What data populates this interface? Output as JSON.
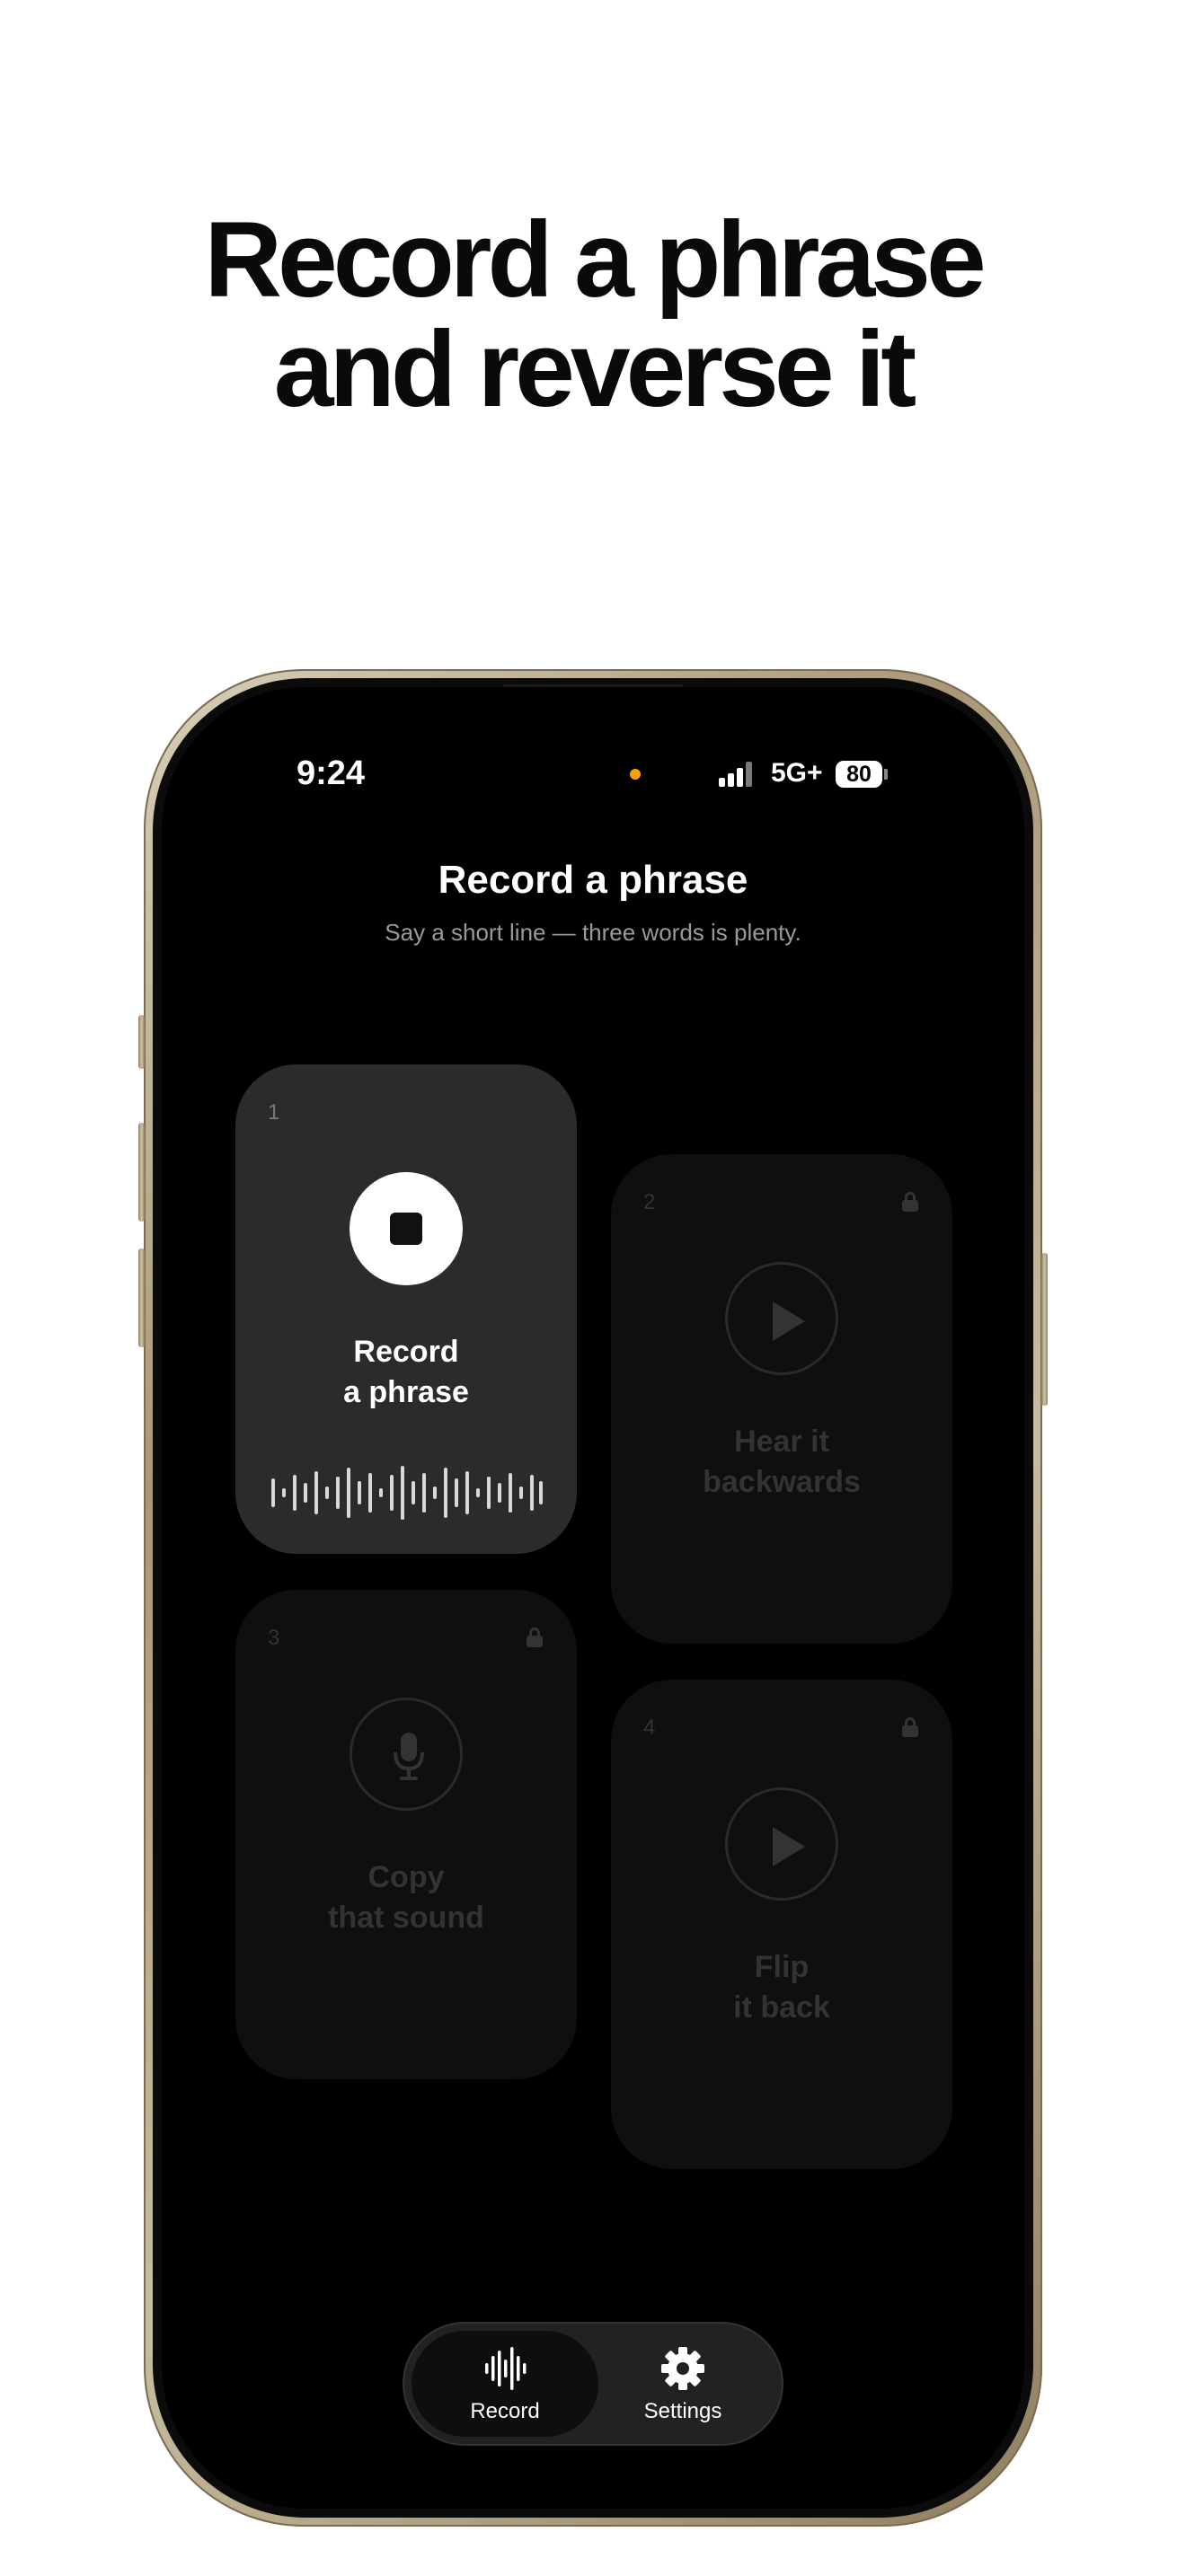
{
  "headline": {
    "line1": "Record a phrase",
    "line2": "and reverse it"
  },
  "status_bar": {
    "time": "9:24",
    "network": "5G+",
    "battery": "80"
  },
  "screen": {
    "title": "Record a phrase",
    "subtitle": "Say a short line — three words is plenty."
  },
  "steps": [
    {
      "number": "1",
      "line1": "Record",
      "line2": "a phrase",
      "state": "active",
      "icon": "stop-icon"
    },
    {
      "number": "2",
      "line1": "Hear it",
      "line2": "backwards",
      "state": "locked",
      "icon": "play-icon"
    },
    {
      "number": "3",
      "line1": "Copy",
      "line2": "that sound",
      "state": "locked",
      "icon": "mic-icon"
    },
    {
      "number": "4",
      "line1": "Flip",
      "line2": "it back",
      "state": "locked",
      "icon": "play-icon"
    }
  ],
  "tabbar": {
    "tabs": [
      {
        "label": "Record",
        "icon": "waveform-icon",
        "selected": true
      },
      {
        "label": "Settings",
        "icon": "gear-icon",
        "selected": false
      }
    ]
  },
  "colors": {
    "accent_privacy_dot": "#ff9f0a",
    "active_card": "#2b2b2d",
    "locked_card": "#0f0f0f"
  }
}
